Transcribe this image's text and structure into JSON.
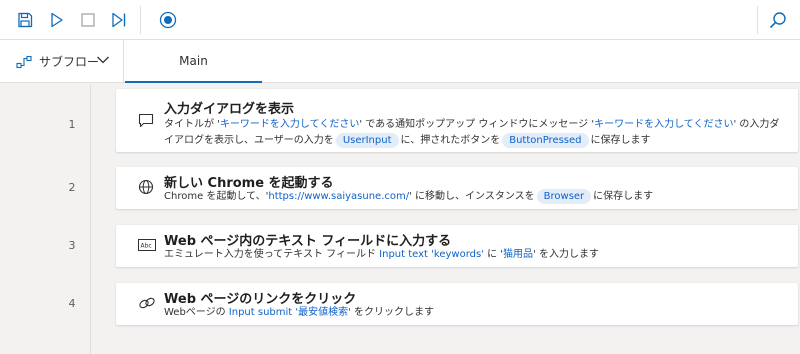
{
  "toolbar": {
    "save_icon": "save-icon",
    "run_icon": "run-icon",
    "stop_icon": "stop-icon",
    "step_icon": "run-next-action-icon",
    "record_icon": "record-icon",
    "search_icon": "search-icon"
  },
  "tabs": {
    "subflow_label": "サブフロー",
    "main_label": "Main"
  },
  "actions": [
    {
      "line": "1",
      "title": "入力ダイアログを表示",
      "desc": {
        "t1": "タイトルが '",
        "l1": "キーワードを入力してください",
        "t2": "' である通知ポップアップ ウィンドウにメッセージ '",
        "l2": "キーワードを入力してください",
        "t3": "' の入力ダイアログを表示し、ユーザーの入力を",
        "v1": "UserInput",
        "t4": "に、押されたボタンを",
        "v2": "ButtonPressed",
        "t5": "に保存します"
      }
    },
    {
      "line": "2",
      "title": "新しい Chrome を起動する",
      "desc": {
        "t1": "Chrome を起動して、'",
        "l1": "https://www.saiyasune.com/",
        "t2": "' に移動し、インスタンスを",
        "v1": "Browser",
        "t3": "に保存します"
      }
    },
    {
      "line": "3",
      "title": "Web ページ内のテキスト フィールドに入力する",
      "desc": {
        "t1": "エミュレート入力を使ってテキスト フィールド ",
        "l1": "Input text 'keywords'",
        "t2": " に '",
        "l2": "猫用品",
        "t3": "' を入力します"
      }
    },
    {
      "line": "4",
      "title": "Web ページのリンクをクリック",
      "desc": {
        "t1": "Webページの ",
        "l1": "Input submit '最安値検索'",
        "t2": " をクリックします"
      }
    }
  ],
  "colors": {
    "accent": "#0f6cbd",
    "literal": "#0f62c8",
    "variable_bg": "#e3ecf9"
  }
}
